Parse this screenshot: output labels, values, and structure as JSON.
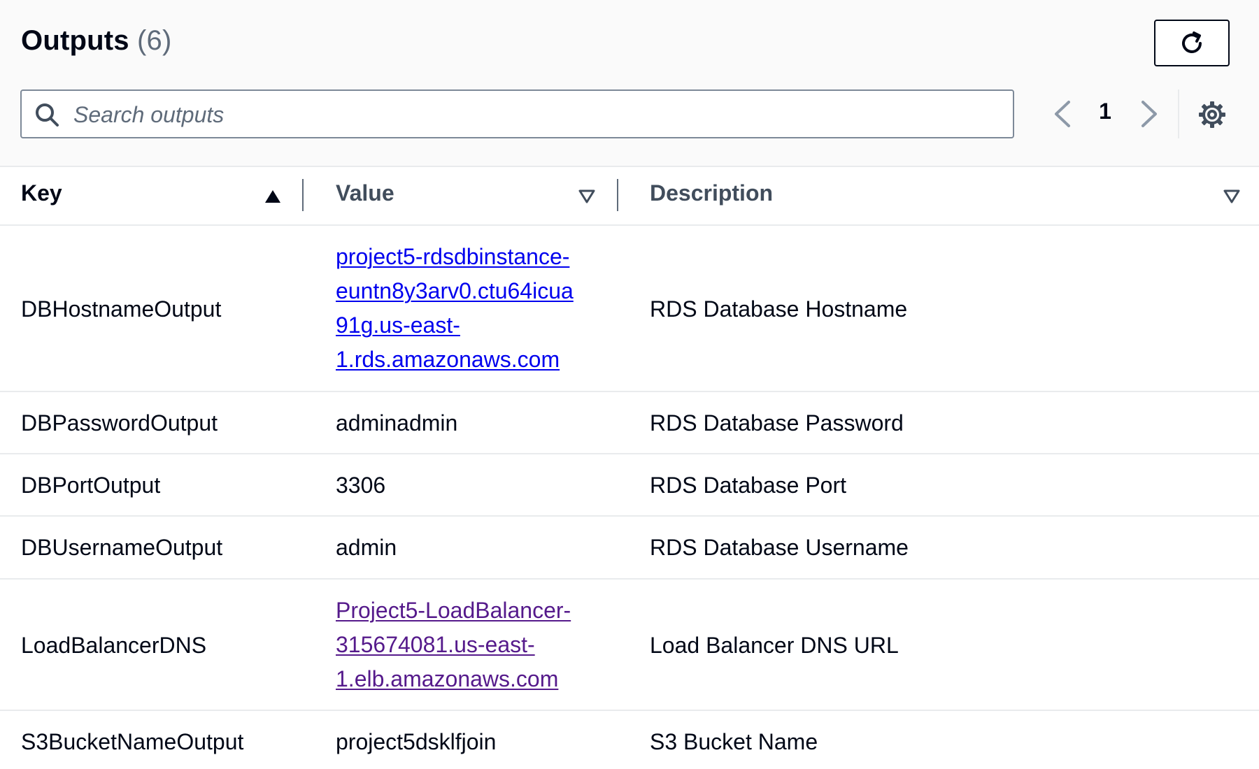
{
  "header": {
    "title": "Outputs",
    "count": "(6)",
    "refresh_icon": "refresh-icon"
  },
  "search": {
    "placeholder": "Search outputs",
    "value": ""
  },
  "pagination": {
    "current_page": "1",
    "prev_icon": "chevron-left-icon",
    "next_icon": "chevron-right-icon",
    "settings_icon": "gear-icon"
  },
  "table": {
    "columns": [
      {
        "label": "Key",
        "sort": "ascending"
      },
      {
        "label": "Value",
        "sort": "none"
      },
      {
        "label": "Description",
        "sort": "none"
      }
    ],
    "rows": [
      {
        "key": "DBHostnameOutput",
        "value_lines": [
          "project5-rdsdbinstance-",
          "euntn8y3arv0.ctu64icua",
          "91g.us-east-",
          "1.rds.amazonaws.com"
        ],
        "is_link": true,
        "visited": false,
        "description": "RDS Database Hostname"
      },
      {
        "key": "DBPasswordOutput",
        "value": "adminadmin",
        "description": "RDS Database Password"
      },
      {
        "key": "DBPortOutput",
        "value": "3306",
        "description": "RDS Database Port"
      },
      {
        "key": "DBUsernameOutput",
        "value": "admin",
        "description": "RDS Database Username"
      },
      {
        "key": "LoadBalancerDNS",
        "value_lines": [
          "Project5-LoadBalancer-",
          "315674081.us-east-",
          "1.elb.amazonaws.com"
        ],
        "is_link": true,
        "visited": true,
        "description": "Load Balancer DNS URL"
      },
      {
        "key": "S3BucketNameOutput",
        "value": "project5dsklfjoin",
        "description": "S3 Bucket Name"
      }
    ]
  },
  "colors": {
    "link": "#0000ee",
    "visited_link": "#551a8b",
    "text": "#000716",
    "muted": "#5f6b7a",
    "divider": "#e9ebed"
  }
}
